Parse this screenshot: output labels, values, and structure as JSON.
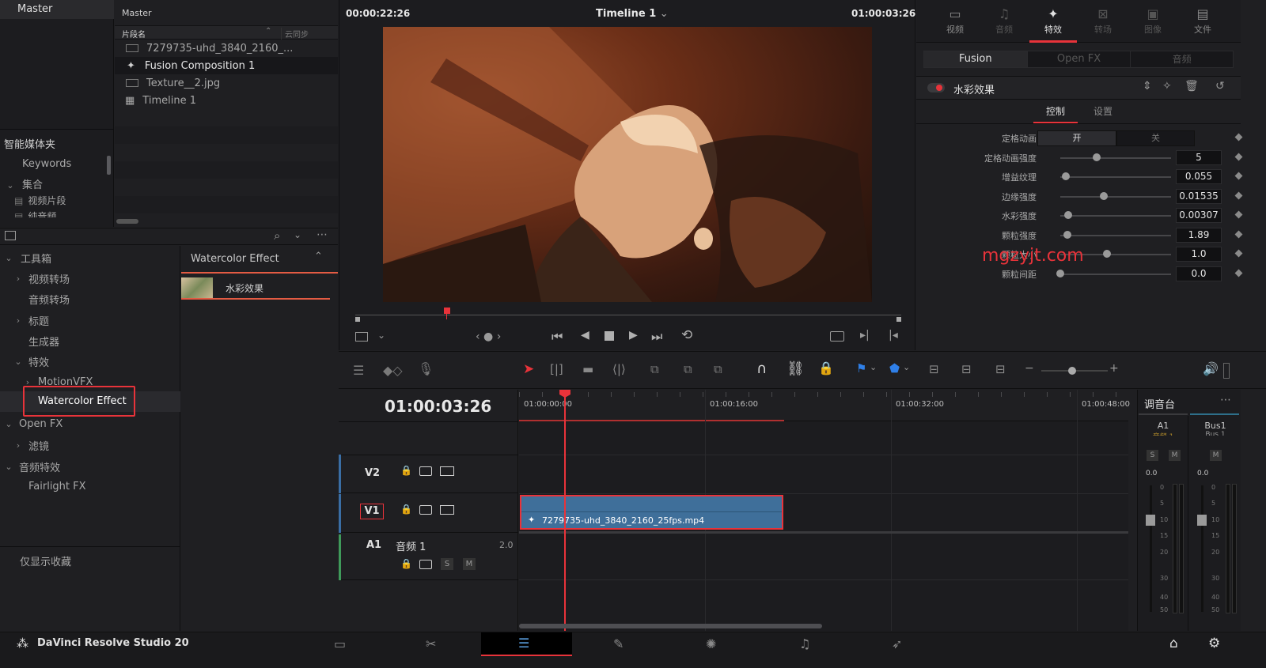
{
  "media_pool": {
    "bin_title": "Master",
    "list_header_title": "Master",
    "col_clip_name": "片段名",
    "col_sync": "云同步",
    "clips": [
      "7279735-uhd_3840_2160_...",
      "Fusion Composition 1",
      "Texture__2.jpg",
      "Timeline 1"
    ],
    "smart_bins_title": "智能媒体夹",
    "smart_bins": [
      "Keywords",
      "集合",
      "视频片段",
      "纯音频"
    ]
  },
  "effects": {
    "tree": [
      "工具箱",
      "视频转场",
      "音频转场",
      "标题",
      "生成器",
      "特效",
      "MotionVFX",
      "Watercolor Effect",
      "Open FX",
      "滤镜",
      "音频特效",
      "Fairlight FX"
    ],
    "favorites_only": "仅显示收藏",
    "group_title": "Watercolor Effect",
    "item_label": "水彩效果"
  },
  "viewer": {
    "timecode_left": "00:00:22:26",
    "timeline_name": "Timeline 1",
    "timecode_right": "01:00:03:26",
    "watermark": "mgzyjt.com"
  },
  "inspector": {
    "tabs": [
      "视频",
      "音频",
      "特效",
      "转场",
      "图像",
      "文件"
    ],
    "active_tab": "特效",
    "subtabs": [
      "Fusion",
      "Open FX",
      "音频"
    ],
    "effect_name": "水彩效果",
    "control_tabs": [
      "控制",
      "设置"
    ],
    "params": [
      {
        "label": "定格动画",
        "type": "toggle",
        "on": "开",
        "off": "关"
      },
      {
        "label": "定格动画强度",
        "value": "5",
        "pos": 0.35
      },
      {
        "label": "增益纹理",
        "value": "0.055",
        "pos": 0.05
      },
      {
        "label": "边缘强度",
        "value": "0.01535",
        "pos": 0.42
      },
      {
        "label": "水彩强度",
        "value": "0.00307",
        "pos": 0.08
      },
      {
        "label": "颗粒强度",
        "value": "1.89",
        "pos": 0.07
      },
      {
        "label": "颗粒大小",
        "value": "1.0",
        "pos": 0.45
      },
      {
        "label": "颗粒间距",
        "value": "0.0",
        "pos": 0.0
      }
    ]
  },
  "timeline": {
    "timecode": "01:00:03:26",
    "ruler": [
      "01:00:00:00",
      "01:00:16:00",
      "01:00:32:00",
      "01:00:48:00"
    ],
    "tracks": [
      {
        "id": "V2"
      },
      {
        "id": "V1"
      },
      {
        "id": "A1",
        "name": "音频 1",
        "channels": "2.0"
      }
    ],
    "clip_name": "7279735-uhd_3840_2160_25fps.mp4",
    "solo": "S",
    "mute": "M"
  },
  "mixer": {
    "title": "调音台",
    "channels": [
      "A1",
      "Bus1"
    ],
    "channel_sub": [
      "音频 1",
      "Bus 1"
    ],
    "solo": "S",
    "mute": "M",
    "level": "0.0",
    "scale": [
      "0",
      "5",
      "10",
      "15",
      "20",
      "30",
      "40",
      "50"
    ]
  },
  "app": {
    "name": "DaVinci Resolve Studio 20"
  }
}
